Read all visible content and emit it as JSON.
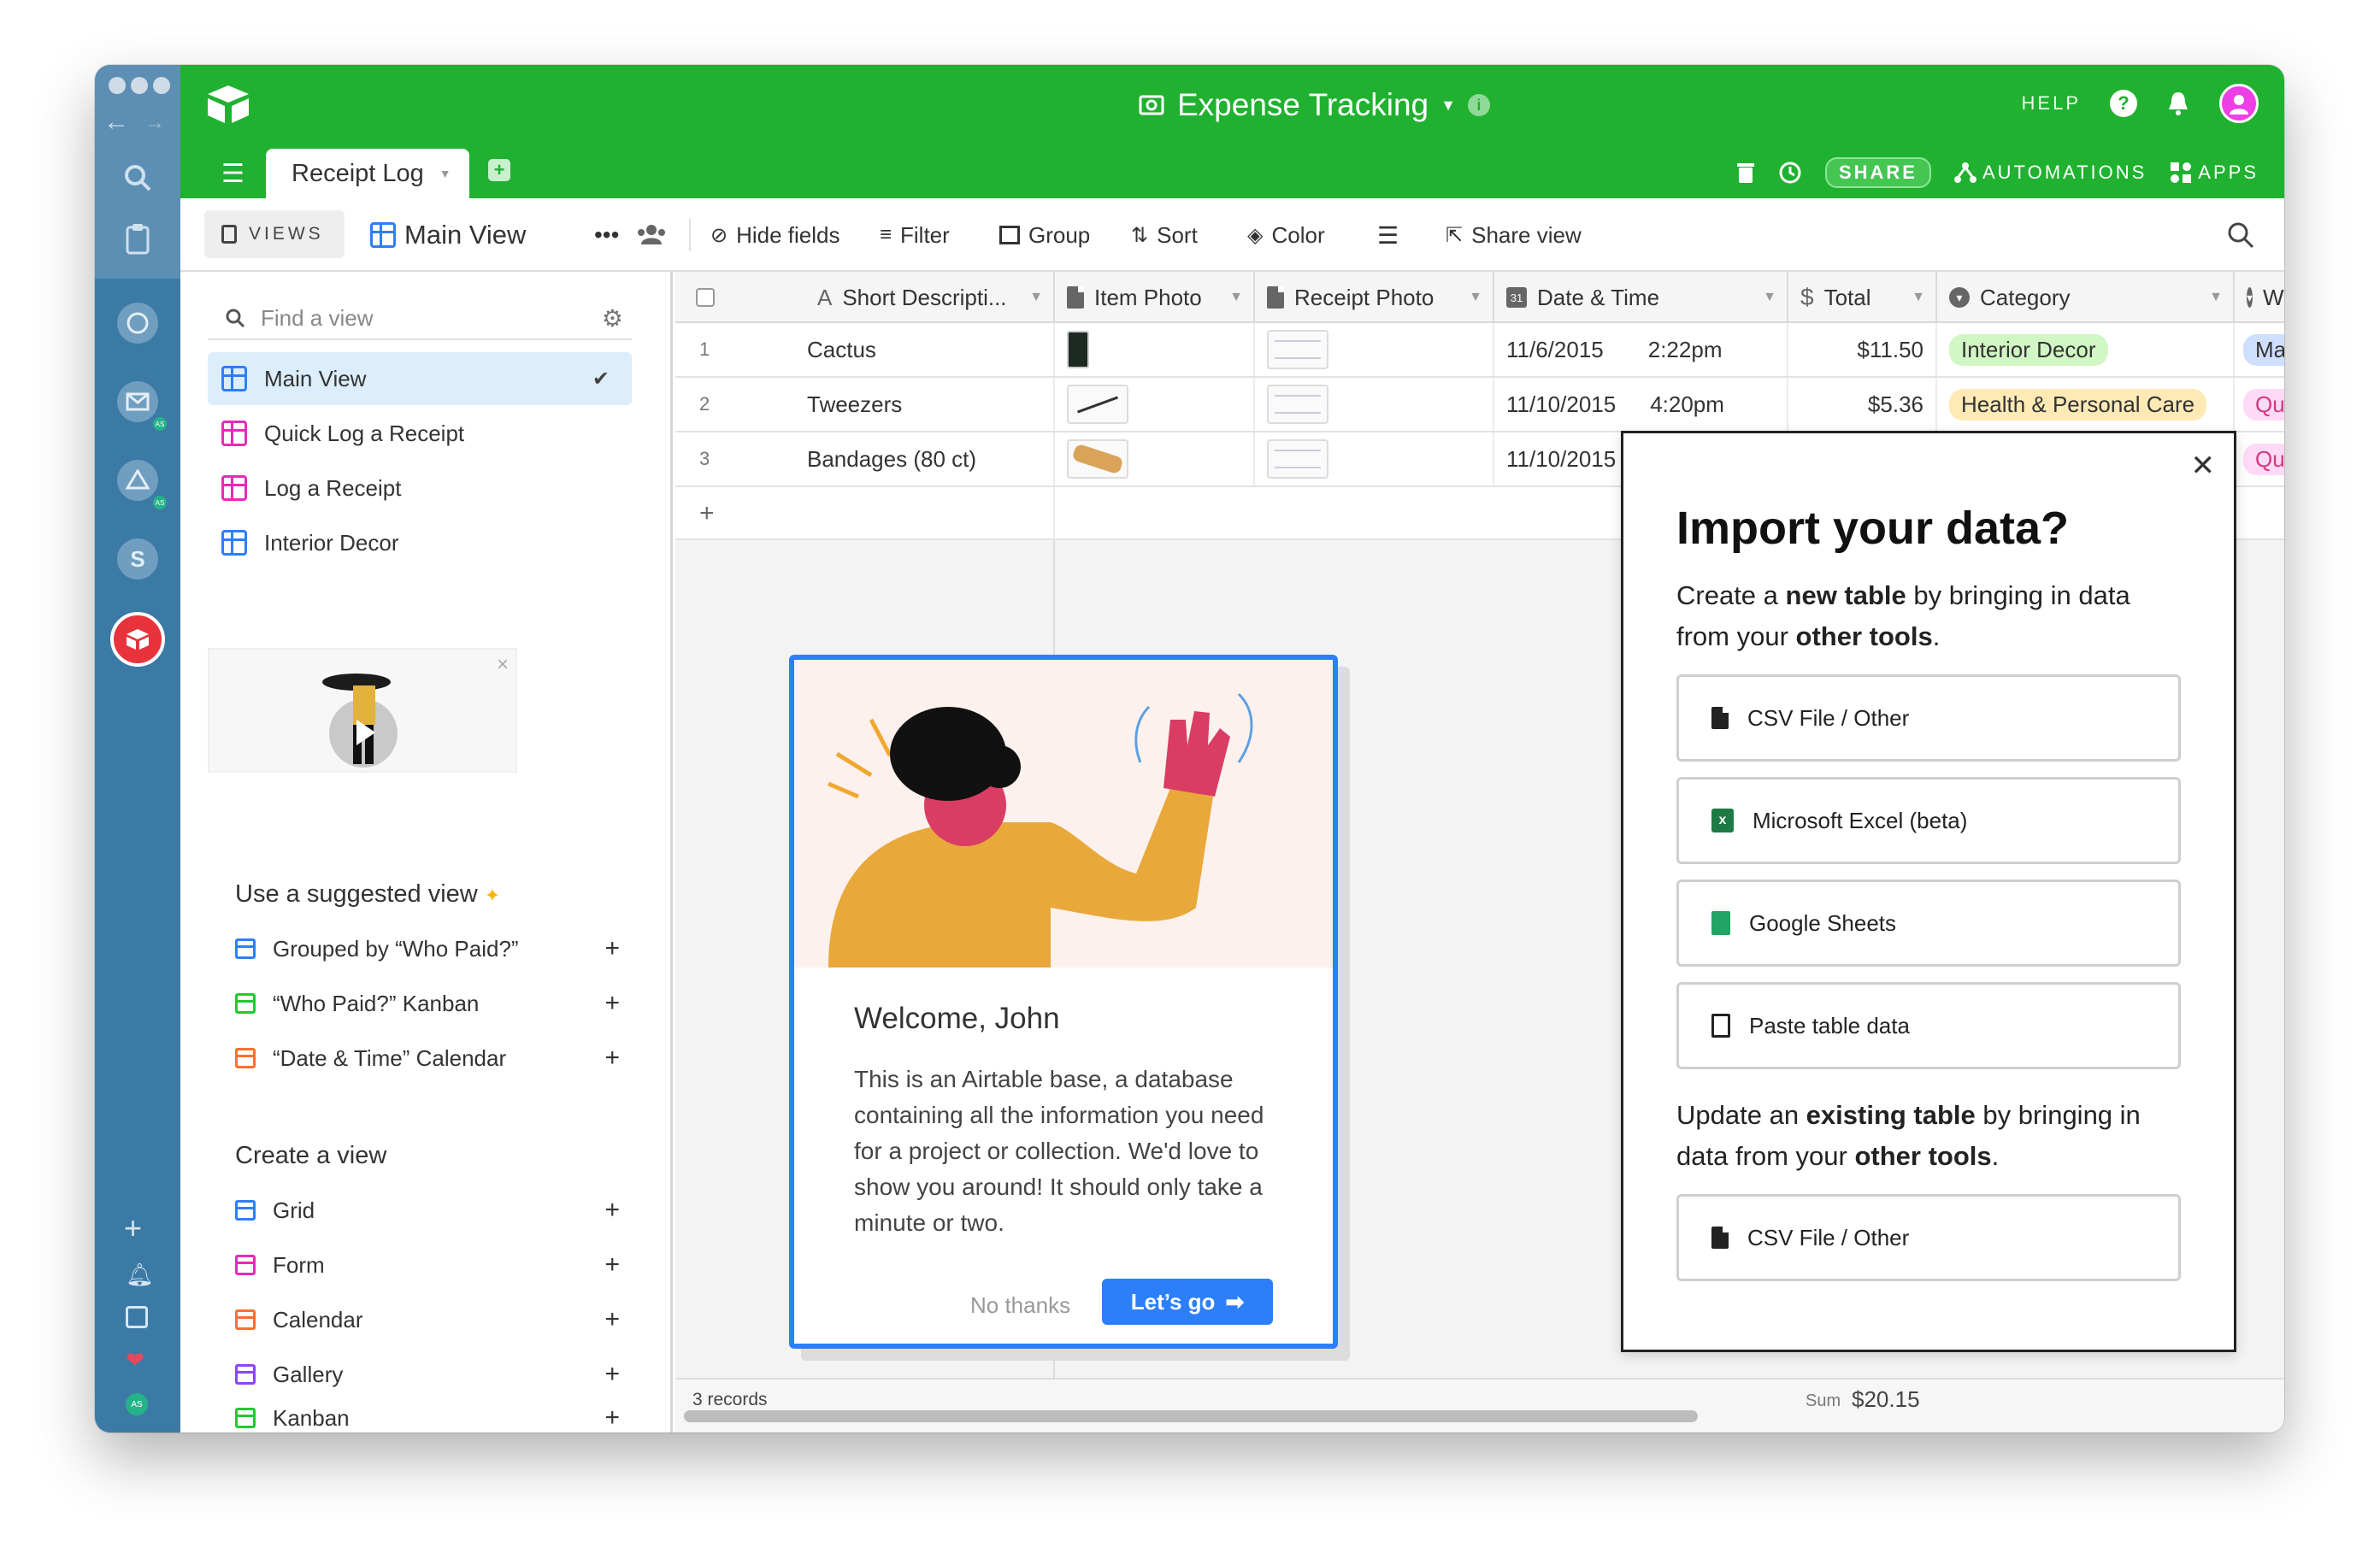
{
  "app": {
    "title": "Expense Tracking",
    "help_label": "HELP",
    "share_label": "SHARE",
    "automations_label": "AUTOMATIONS",
    "apps_label": "APPS",
    "brand_color": "#20b130"
  },
  "tabs": {
    "active": "Receipt Log"
  },
  "toolbar": {
    "views_label": "VIEWS",
    "view_name": "Main View",
    "hide_fields": "Hide fields",
    "filter": "Filter",
    "group": "Group",
    "sort": "Sort",
    "color": "Color",
    "share_view": "Share view"
  },
  "sidebar": {
    "find_placeholder": "Find a view",
    "views": [
      {
        "label": "Main View",
        "color": "#2d7ff9",
        "active": true
      },
      {
        "label": "Quick Log a Receipt",
        "color": "#e929ba"
      },
      {
        "label": "Log a Receipt",
        "color": "#e929ba"
      },
      {
        "label": "Interior Decor",
        "color": "#2d7ff9"
      }
    ],
    "suggested_title": "Use a suggested view",
    "suggested": [
      {
        "label": "Grouped by “Who Paid?”",
        "color": "#2d7ff9"
      },
      {
        "label": "“Who Paid?” Kanban",
        "color": "#20c933"
      },
      {
        "label": "“Date & Time” Calendar",
        "color": "#ff6f2c"
      }
    ],
    "create_title": "Create a view",
    "create": [
      {
        "label": "Grid",
        "color": "#2d7ff9"
      },
      {
        "label": "Form",
        "color": "#e929ba"
      },
      {
        "label": "Calendar",
        "color": "#ff6f2c"
      },
      {
        "label": "Gallery",
        "color": "#8b46ff"
      },
      {
        "label": "Kanban",
        "color": "#20c933"
      }
    ]
  },
  "grid": {
    "columns": [
      "Short Descripti...",
      "Item Photo",
      "Receipt Photo",
      "Date & Time",
      "Total",
      "Category",
      "Wh"
    ],
    "rows": [
      {
        "num": "1",
        "desc": "Cactus",
        "date": "11/6/2015",
        "time": "2:22pm",
        "total": "$11.50",
        "category": "Interior Decor",
        "cat_color": "#d1f7c4",
        "who": "Marit",
        "who_color": "#cfdfff"
      },
      {
        "num": "2",
        "desc": "Tweezers",
        "date": "11/10/2015",
        "time": "4:20pm",
        "total": "$5.36",
        "category": "Health & Personal Care",
        "cat_color": "#ffeab6",
        "who": "Quin",
        "who_color": "#ffdaf6"
      },
      {
        "num": "3",
        "desc": "Bandages (80 ct)",
        "date": "11/10/2015",
        "time": "",
        "total": "",
        "category": "",
        "cat_color": "",
        "who": "Quin",
        "who_color": "#ffdaf6"
      }
    ],
    "records_label": "3 records",
    "sum_label": "Sum",
    "sum_value": "$20.15"
  },
  "welcome": {
    "title": "Welcome, John",
    "body": "This is an Airtable base, a database containing all the information you need for a project or collection. We'd love to show you around! It should only take a minute or two.",
    "no_thanks": "No thanks",
    "lets_go": "Let’s go"
  },
  "import": {
    "title": "Import your data?",
    "line1_pre": "Create a ",
    "line1_bold1": "new table",
    "line1_mid": " by bringing in data from your ",
    "line1_bold2": "other tools",
    "line1_post": ".",
    "options": [
      "CSV File / Other",
      "Microsoft Excel (beta)",
      "Google Sheets",
      "Paste table data"
    ],
    "line2_pre": "Update an ",
    "line2_bold1": "existing table",
    "line2_mid": " by bringing in data from your ",
    "line2_bold2": "other tools",
    "line2_post": ".",
    "option2": "CSV File / Other"
  }
}
